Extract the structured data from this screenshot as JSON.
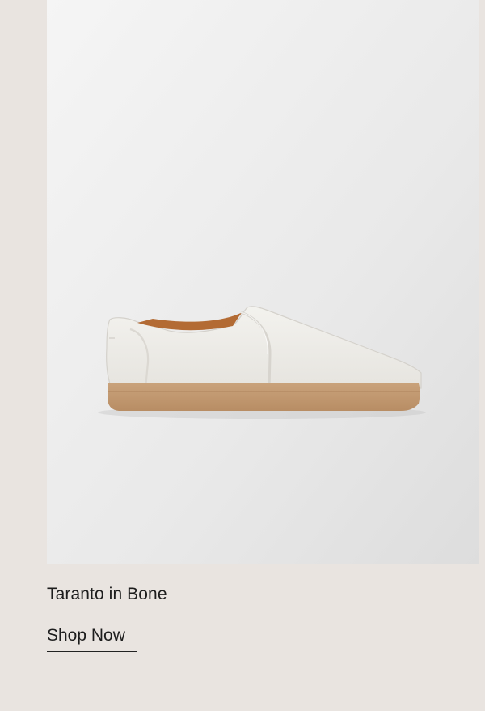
{
  "product": {
    "image_alt": "white slip-on sneaker with gum sole",
    "name": "Taranto in Bone",
    "cta_label": "Shop Now",
    "colors": {
      "page_background": "#e9e4e0",
      "image_background": "#ececec",
      "shoe_upper": "#efeeea",
      "shoe_sole": "#c59a71",
      "shoe_lining": "#b36b34",
      "text": "#1d1d1d"
    }
  }
}
